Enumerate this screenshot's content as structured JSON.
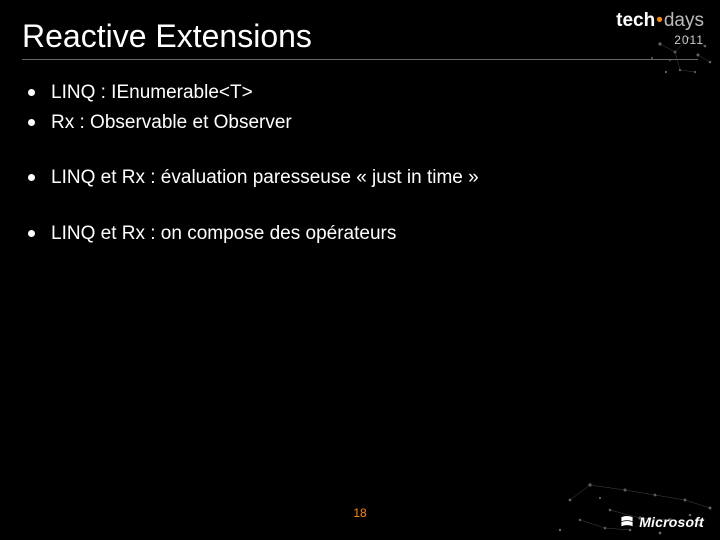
{
  "title": "Reactive Extensions",
  "bullets": {
    "group0": {
      "item0": "LINQ : IEnumerable<T>",
      "item1": "Rx : Observable et Observer"
    },
    "group1": {
      "item0": "LINQ et Rx : évaluation paresseuse « just in time »"
    },
    "group2": {
      "item0": "LINQ et Rx : on compose des opérateurs"
    }
  },
  "page_number": "18",
  "branding": {
    "event_prefix": "tech",
    "event_suffix": "days",
    "event_year": "2011",
    "company": "Microsoft"
  },
  "colors": {
    "accent": "#ff8c00",
    "bg": "#000000",
    "text": "#ffffff"
  }
}
